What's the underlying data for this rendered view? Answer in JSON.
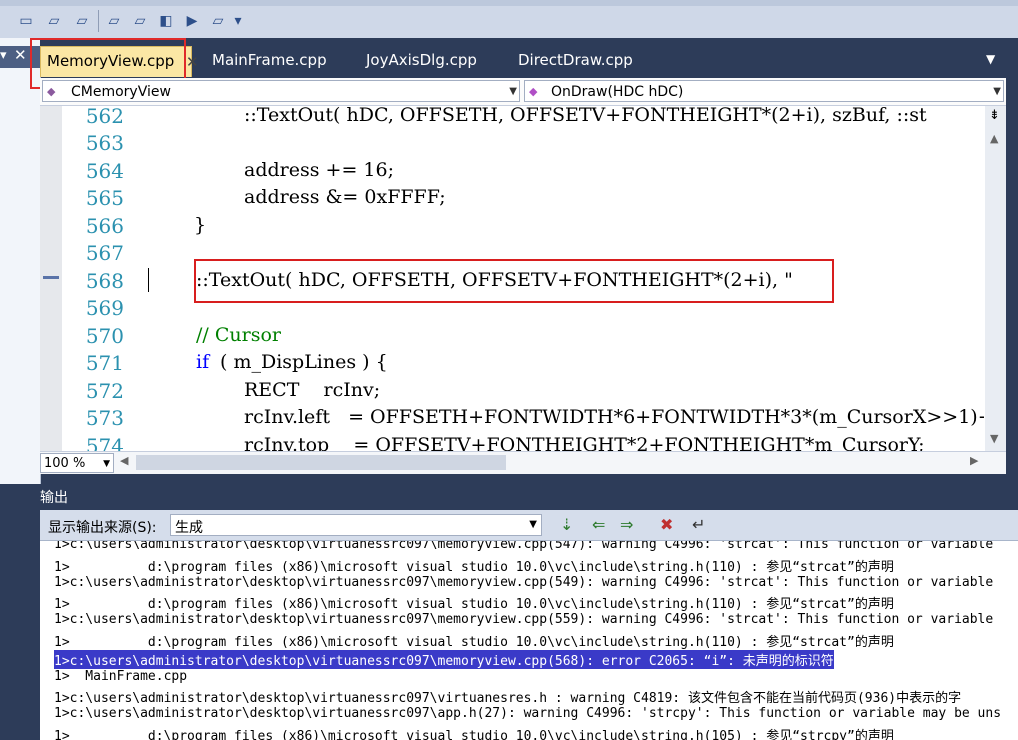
{
  "tabs": [
    {
      "label": "MemoryView.cpp",
      "active": true
    },
    {
      "label": "MainFrame.cpp",
      "active": false
    },
    {
      "label": "JoyAxisDlg.cpp",
      "active": false
    },
    {
      "label": "DirectDraw.cpp",
      "active": false
    }
  ],
  "nav": {
    "class_combo": "CMemoryView",
    "member_combo": "OnDraw(HDC hDC)"
  },
  "editor": {
    "line_numbers": [
      "562",
      "563",
      "564",
      "565",
      "566",
      "567",
      "568",
      "569",
      "570",
      "571",
      "572",
      "573",
      "574"
    ],
    "lines": [
      "::TextOut( hDC, OFFSETH, OFFSETV+FONTHEIGHT*(2+i), szBuf, ::st",
      "",
      "address += 16;",
      "address &= 0xFFFF;",
      "}",
      "",
      "::TextOut( hDC, OFFSETH, OFFSETV+FONTHEIGHT*(2+i), \"",
      "",
      "// Cursor",
      "( m_DispLines ) {",
      "RECT    rcInv;",
      "rcInv.left   = OFFSETH+FONTWIDTH*6+FONTWIDTH*3*(m_CursorX>>1)+",
      "rcInv.top    = OFFSETV+FONTHEIGHT*2+FONTHEIGHT*m_CursorY;"
    ],
    "keyword_if": "if",
    "zoom": "100 %"
  },
  "output": {
    "title": "输出",
    "source_label": "显示输出来源(S):",
    "source_value": "生成",
    "lines": [
      "1>c:\\users\\administrator\\desktop\\virtuanessrc097\\memoryview.cpp(547): warning C4996: 'strcat': This function or variable",
      "1>          d:\\program files (x86)\\microsoft visual studio 10.0\\vc\\include\\string.h(110) : 参见“strcat”的声明",
      "1>c:\\users\\administrator\\desktop\\virtuanessrc097\\memoryview.cpp(549): warning C4996: 'strcat': This function or variable",
      "1>          d:\\program files (x86)\\microsoft visual studio 10.0\\vc\\include\\string.h(110) : 参见“strcat”的声明",
      "1>c:\\users\\administrator\\desktop\\virtuanessrc097\\memoryview.cpp(559): warning C4996: 'strcat': This function or variable",
      "1>          d:\\program files (x86)\\microsoft visual studio 10.0\\vc\\include\\string.h(110) : 参见“strcat”的声明",
      "1>c:\\users\\administrator\\desktop\\virtuanessrc097\\memoryview.cpp(568): error C2065: “i”: 未声明的标识符",
      "1>  MainFrame.cpp",
      "1>c:\\users\\administrator\\desktop\\virtuanessrc097\\virtuanesres.h : warning C4819: 该文件包含不能在当前代码页(936)中表示的字",
      "1>c:\\users\\administrator\\desktop\\virtuanessrc097\\app.h(27): warning C4996: 'strcpy': This function or variable may be uns",
      "1>          d:\\program files (x86)\\microsoft visual studio 10.0\\vc\\include\\string.h(105) : 参见“strcpy”的声明"
    ]
  },
  "colors": {
    "accent_tab": "#fbe7a4",
    "highlight_red": "#e02a2a",
    "linenumber": "#2b91af",
    "selected_line": "#3a3ac8"
  }
}
